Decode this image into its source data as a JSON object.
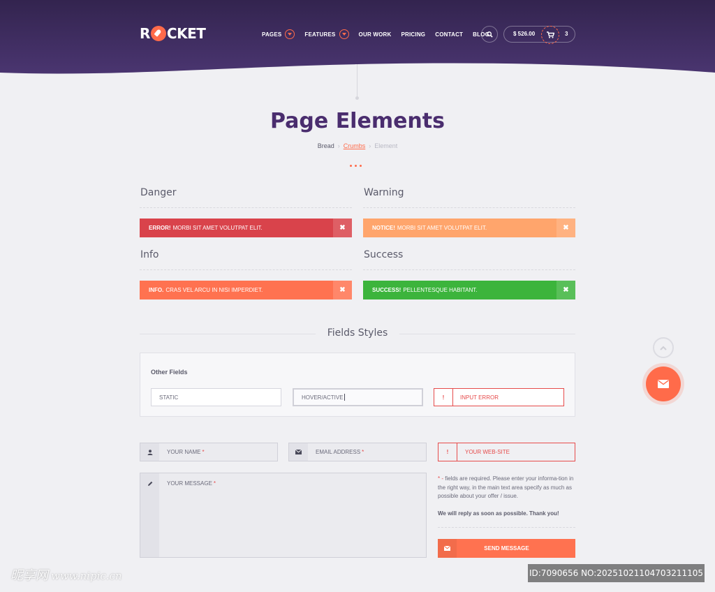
{
  "brand": {
    "logo_text_1": "R",
    "logo_text_2": "CKET"
  },
  "nav": {
    "items": [
      {
        "label": "PAGES"
      },
      {
        "label": "FEATURES"
      },
      {
        "label": "OUR WORK"
      },
      {
        "label": "PRICING"
      },
      {
        "label": "CONTACT"
      },
      {
        "label": "BLOG"
      }
    ],
    "cart_total": "$ 526.00",
    "cart_count": "3"
  },
  "page": {
    "title": "Page Elements",
    "breadcrumb": [
      "Bread",
      "Crumbs",
      "Element"
    ]
  },
  "alerts": {
    "danger": {
      "heading": "Danger",
      "strong": "ERROR!",
      "text": "MORBI SIT AMET VOLUTPAT ELIT.",
      "color": "#d9434b"
    },
    "warning": {
      "heading": "Warning",
      "strong": "NOTICE!",
      "text": "MORBI SIT AMET VOLUTPAT ELIT.",
      "color": "#ffa56c"
    },
    "info": {
      "heading": "Info",
      "strong": "INFO.",
      "text": "CRAS VEL ARCU IN NISI IMPERDIET.",
      "color": "#ff7250"
    },
    "success": {
      "heading": "Success",
      "strong": "SUCCESS!",
      "text": "PELLENTESQUE HABITANT.",
      "color": "#3cb43c"
    },
    "close_glyph": "✖"
  },
  "fields": {
    "section_title": "Fields Styles",
    "box_label": "Other Fields",
    "static": "STATIC",
    "hover": "HOVER/ACTIVE",
    "error": "INPUT ERROR",
    "error_glyph": "!"
  },
  "form": {
    "name_placeholder": "YOUR NAME",
    "email_placeholder": "EMAIL ADDRESS",
    "website_placeholder": "YOUR WEB-SITE",
    "message_placeholder": "YOUR MESSAGE",
    "required_star": "*",
    "note_star": "* -",
    "note": "fields are required. Please enter your informa-tion in the right way, in the main text area specify as much as possible about your offer / issue.",
    "note_bold": "We will reply as soon as possible. Thank you!",
    "send_label": "SEND MESSAGE"
  },
  "watermark": {
    "left_brand": "昵享网",
    "left_url": "www.nipic.cn",
    "right": "ID:7090656 NO:20251021104703211105"
  },
  "colors": {
    "accent": "#ff6b4a",
    "header": "#3b2a5a",
    "title": "#4a2d6e"
  },
  "icons": [
    "search-icon",
    "cart-icon",
    "user-icon",
    "envelope-icon",
    "pencil-icon",
    "chevron-up-icon",
    "mail-icon",
    "close-icon"
  ]
}
